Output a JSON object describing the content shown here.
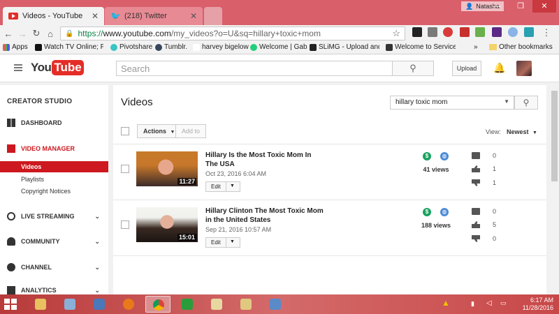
{
  "browser": {
    "tabs": [
      {
        "label": "Videos - YouTube",
        "active": true
      },
      {
        "label": "(218) Twitter",
        "active": false
      }
    ],
    "profile_name": "Natasha",
    "url_scheme": "https://",
    "url_host": "www.youtube.com",
    "url_path": "/my_videos?o=U&sq=hillary+toxic+mom",
    "bookmarks": [
      {
        "label": "Apps",
        "icon": "apps-grid-icon"
      },
      {
        "label": "Watch TV Online; Pay",
        "icon": "x-site-icon"
      },
      {
        "label": "Pivotshare",
        "icon": "pivotshare-icon"
      },
      {
        "label": "Tumblr.",
        "icon": "tumblr-icon"
      },
      {
        "label": "harvey bigelow",
        "icon": "page-icon"
      },
      {
        "label": "Welcome | Gab",
        "icon": "gab-frog-icon"
      },
      {
        "label": "SLiMG - Upload and S",
        "icon": "slimg-icon"
      },
      {
        "label": "Welcome to Service C",
        "icon": "service-icon"
      },
      {
        "label": "»",
        "icon": ""
      },
      {
        "label": "Other bookmarks",
        "icon": "folder-icon"
      }
    ]
  },
  "youtube": {
    "logo_you": "You",
    "logo_tube": "Tube",
    "search_placeholder": "Search",
    "upload_label": "Upload",
    "sidebar": {
      "title": "CREATOR STUDIO",
      "items": [
        {
          "label": "DASHBOARD",
          "icon": "dashboard-icon",
          "chevron": false
        },
        {
          "label": "VIDEO MANAGER",
          "icon": "video-manager-icon",
          "chevron": false,
          "color": "#cc181e"
        },
        {
          "label": "LIVE STREAMING",
          "icon": "live-streaming-icon",
          "chevron": true
        },
        {
          "label": "COMMUNITY",
          "icon": "community-icon",
          "chevron": true
        },
        {
          "label": "CHANNEL",
          "icon": "channel-icon",
          "chevron": true
        },
        {
          "label": "ANALYTICS",
          "icon": "analytics-icon",
          "chevron": true
        }
      ],
      "subitems": [
        {
          "label": "Videos",
          "active": true
        },
        {
          "label": "Playlists",
          "active": false
        },
        {
          "label": "Copyright Notices",
          "active": false
        }
      ]
    },
    "panel": {
      "title": "Videos",
      "search_value": "hillary toxic mom",
      "actions_label": "Actions",
      "add_to_label": "Add to",
      "view_label": "View:",
      "view_value": "Newest"
    },
    "videos": [
      {
        "title": "Hillary Is the Most Toxic Mom In The USA",
        "date": "Oct 23, 2016 6:04 AM",
        "duration": "11:27",
        "views": "41 views",
        "comments": "0",
        "likes": "1",
        "dislikes": "1",
        "edit_label": "Edit"
      },
      {
        "title": "Hillary Clinton The Most Toxic Mom in the United States",
        "date": "Sep 21, 2016 10:57 AM",
        "duration": "15:01",
        "views": "188 views",
        "comments": "0",
        "likes": "5",
        "dislikes": "0",
        "edit_label": "Edit"
      }
    ]
  },
  "taskbar": {
    "time": "6:17 AM",
    "date": "11/28/2016"
  },
  "colors": {
    "accent": "#cc181e",
    "chrome_frame": "#d95f6b",
    "money": "#1aa260",
    "public": "#4a8ad6"
  }
}
